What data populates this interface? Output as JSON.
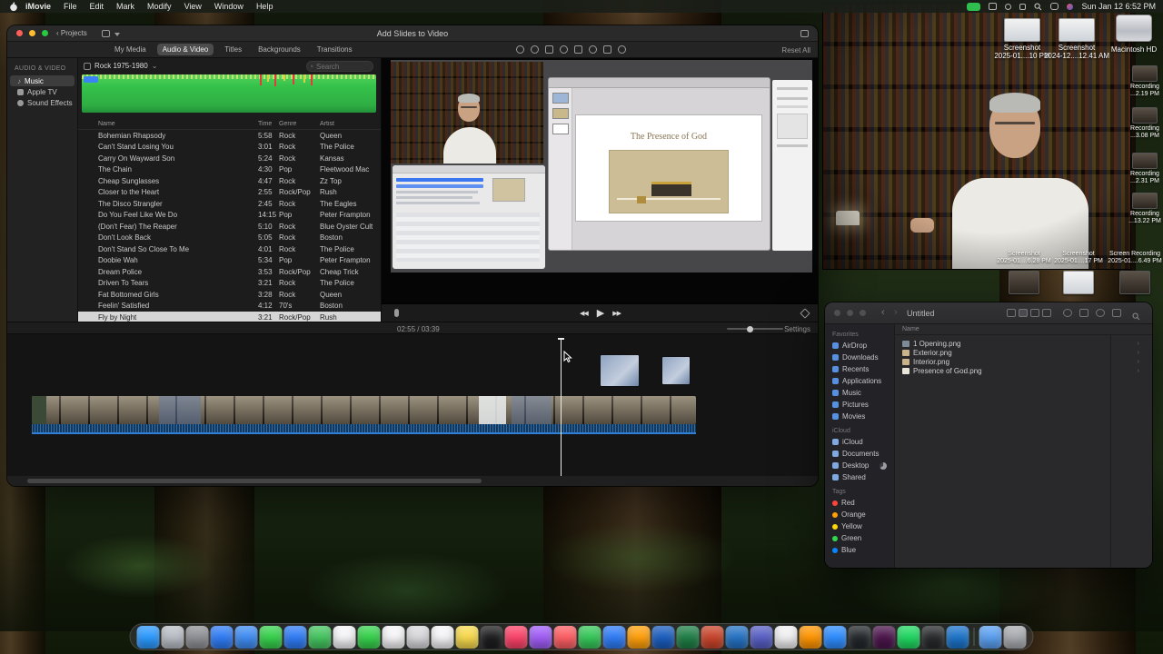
{
  "menu_bar": {
    "app_items": [
      "iMovie",
      "File",
      "Edit",
      "Mark",
      "Modify",
      "View",
      "Window",
      "Help"
    ],
    "clock": "Sun Jan 12 6:52 PM"
  },
  "imovie": {
    "window_title": "Add Slides to Video",
    "projects_button": "Projects",
    "projects_chevron": "‹",
    "tabs": [
      {
        "label": "My Media"
      },
      {
        "label": "Audio & Video",
        "selected": true
      },
      {
        "label": "Titles"
      },
      {
        "label": "Backgrounds"
      },
      {
        "label": "Transitions"
      }
    ],
    "reset_all": "Reset All",
    "sidebar": {
      "header": "AUDIO & VIDEO",
      "items": [
        {
          "label": "Music",
          "selected": true
        },
        {
          "label": "Apple TV"
        },
        {
          "label": "Sound Effects"
        }
      ]
    },
    "library": {
      "source": "Rock 1975-1980",
      "source_chevron": "⌄",
      "search_placeholder": "Search",
      "columns": [
        "Name",
        "Time",
        "Genre",
        "Artist"
      ],
      "songs": [
        {
          "name": "Bohemian Rhapsody",
          "time": "5:58",
          "genre": "Rock",
          "artist": "Queen"
        },
        {
          "name": "Can't Stand Losing You",
          "time": "3:01",
          "genre": "Rock",
          "artist": "The Police"
        },
        {
          "name": "Carry On Wayward Son",
          "time": "5:24",
          "genre": "Rock",
          "artist": "Kansas"
        },
        {
          "name": "The Chain",
          "time": "4:30",
          "genre": "Pop",
          "artist": "Fleetwood Mac"
        },
        {
          "name": "Cheap Sunglasses",
          "time": "4:47",
          "genre": "Rock",
          "artist": "Zz Top"
        },
        {
          "name": "Closer to the Heart",
          "time": "2:55",
          "genre": "Rock/Pop",
          "artist": "Rush"
        },
        {
          "name": "The Disco Strangler",
          "time": "2:45",
          "genre": "Rock",
          "artist": "The Eagles"
        },
        {
          "name": "Do You Feel Like We Do",
          "time": "14:15",
          "genre": "Pop",
          "artist": "Peter Frampton"
        },
        {
          "name": "(Don't Fear) The Reaper",
          "time": "5:10",
          "genre": "Rock",
          "artist": "Blue Oyster Cult"
        },
        {
          "name": "Don't Look Back",
          "time": "5:05",
          "genre": "Rock",
          "artist": "Boston"
        },
        {
          "name": "Don't Stand So Close To Me",
          "time": "4:01",
          "genre": "Rock",
          "artist": "The Police"
        },
        {
          "name": "Doobie Wah",
          "time": "5:34",
          "genre": "Pop",
          "artist": "Peter Frampton"
        },
        {
          "name": "Dream Police",
          "time": "3:53",
          "genre": "Rock/Pop",
          "artist": "Cheap Trick"
        },
        {
          "name": "Driven To Tears",
          "time": "3:21",
          "genre": "Rock",
          "artist": "The Police"
        },
        {
          "name": "Fat Bottomed Girls",
          "time": "3:28",
          "genre": "Rock",
          "artist": "Queen"
        },
        {
          "name": "Feelin' Satisfied",
          "time": "4:12",
          "genre": "70's",
          "artist": "Boston"
        },
        {
          "name": "Fly by Night",
          "time": "3:21",
          "genre": "Rock/Pop",
          "artist": "Rush",
          "selected": true
        }
      ]
    },
    "viewer": {
      "slide_title": "The Presence of God"
    },
    "transport": {
      "prev_label": "◀◀",
      "play_label": "▶",
      "next_label": "▶▶",
      "time_display": "02:55 / 03:39",
      "settings_label": "Settings"
    }
  },
  "finder": {
    "window_title": "Untitled",
    "back_chevron": "‹",
    "forward_chevron": "›",
    "columns": [
      "Name"
    ],
    "sidebar": {
      "favorites_header": "Favorites",
      "favorites": [
        "AirDrop",
        "Downloads",
        "Recents",
        "Applications",
        "Music",
        "Pictures",
        "Movies"
      ],
      "icloud_header": "iCloud",
      "icloud": [
        "iCloud",
        "Documents",
        "Desktop",
        "Shared"
      ],
      "tags_header": "Tags",
      "tags": [
        {
          "label": "Red",
          "color": "#ff453a"
        },
        {
          "label": "Orange",
          "color": "#ff9f0a"
        },
        {
          "label": "Yellow",
          "color": "#ffd60a"
        },
        {
          "label": "Green",
          "color": "#32d74b"
        },
        {
          "label": "Blue",
          "color": "#0a84ff"
        }
      ]
    },
    "files": [
      {
        "name": "1 Opening.png",
        "color": "#7d8b99"
      },
      {
        "name": "Exterior.png",
        "color": "#c9b48a"
      },
      {
        "name": "Interior.png",
        "color": "#c9b48a"
      },
      {
        "name": "Presence of God.png",
        "color": "#e8e4da"
      }
    ]
  },
  "desktop_icons": {
    "top_right": [
      {
        "line1": "Screenshot",
        "line2": "2025-01....10 PM"
      },
      {
        "line1": "Screenshot",
        "line2": "2024-12....12.41 AM"
      },
      {
        "line1": "Macintosh HD",
        "line2": ""
      }
    ],
    "right_edge": [
      {
        "line1": "Recording",
        "line2": "...2.19 PM"
      },
      {
        "line1": "Recording",
        "line2": "...3.08 PM"
      },
      {
        "line1": "Recording",
        "line2": "...2.31 PM"
      },
      {
        "line1": "Recording",
        "line2": "...13.22 PM"
      }
    ],
    "below_webcam": [
      {
        "line1": "Screenshot",
        "line2": "2025-01....6.28 PM"
      },
      {
        "line1": "Screenshot",
        "line2": "2025-01....17 PM"
      },
      {
        "line1": "Screen Recording",
        "line2": "2025-01....6.49 PM"
      }
    ]
  },
  "dock": {
    "apps": [
      {
        "name": "finder",
        "color": "#2b99ff"
      },
      {
        "name": "launchpad",
        "color": "#b9bec5"
      },
      {
        "name": "system-settings",
        "color": "#8e9095"
      },
      {
        "name": "app-store",
        "color": "#2f7cf6"
      },
      {
        "name": "safari",
        "color": "#3f8cf3"
      },
      {
        "name": "messages",
        "color": "#35d14b"
      },
      {
        "name": "mail",
        "color": "#2f7cf6"
      },
      {
        "name": "maps",
        "color": "#43c45e"
      },
      {
        "name": "photos",
        "color": "#f5f5f7"
      },
      {
        "name": "facetime",
        "color": "#35d14b"
      },
      {
        "name": "calendar",
        "color": "#f5f5f7"
      },
      {
        "name": "contacts",
        "color": "#d8d8dc"
      },
      {
        "name": "reminders",
        "color": "#f5f5f7"
      },
      {
        "name": "notes",
        "color": "#f7d94c"
      },
      {
        "name": "tv",
        "color": "#1d1d1f"
      },
      {
        "name": "music",
        "color": "#fb4268"
      },
      {
        "name": "podcasts",
        "color": "#a05cf7"
      },
      {
        "name": "news",
        "color": "#fd5e63"
      },
      {
        "name": "numbers",
        "color": "#35c759"
      },
      {
        "name": "keynote",
        "color": "#2f7cf6"
      },
      {
        "name": "pages",
        "color": "#ff9f0a"
      },
      {
        "name": "word",
        "color": "#1a5dbe"
      },
      {
        "name": "excel",
        "color": "#1e7e45"
      },
      {
        "name": "powerpoint",
        "color": "#c8442a"
      },
      {
        "name": "outlook",
        "color": "#2572c4"
      },
      {
        "name": "teams",
        "color": "#585fc4"
      },
      {
        "name": "chrome",
        "color": "#f0f0f2"
      },
      {
        "name": "firefox",
        "color": "#ff9500"
      },
      {
        "name": "zoom",
        "color": "#2d8cff"
      },
      {
        "name": "obs",
        "color": "#23272b"
      },
      {
        "name": "slack",
        "color": "#4a154b"
      },
      {
        "name": "spotify",
        "color": "#1ed760"
      },
      {
        "name": "terminal",
        "color": "#28292c"
      },
      {
        "name": "vscode",
        "color": "#1b73c9"
      }
    ],
    "right": [
      {
        "name": "downloads-folder",
        "color": "#5a9ff0"
      },
      {
        "name": "trash",
        "color": "#a8abb0"
      }
    ]
  }
}
